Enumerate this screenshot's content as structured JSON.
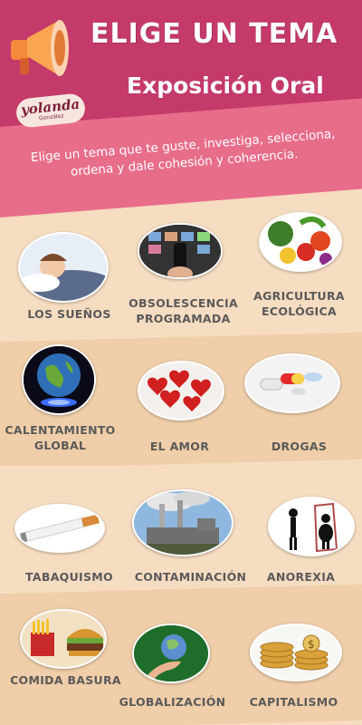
{
  "header": {
    "title_line1": "ELIGE UN TEMA",
    "title_line2": "Exposición Oral",
    "logo_name": "yolanda",
    "logo_sub": "González",
    "instructions": "Elige un tema que te guste, investiga, selecciona, ordena y dale cohesión y coherencia."
  },
  "colors": {
    "header": "#c43a6a",
    "band": "#e86d8a",
    "row_light": "#f6dcc0",
    "row_dark": "#f0cea9",
    "label": "#5a5a5a"
  },
  "topics": [
    {
      "label": "LOS SUEÑOS",
      "icon": "sleeping-child-icon"
    },
    {
      "label": "OBSOLESCENCIA PROGRAMADA",
      "icon": "tv-remote-icon"
    },
    {
      "label": "AGRICULTURA ECOLÓGICA",
      "icon": "vegetables-icon"
    },
    {
      "label": "CALENTAMIENTO GLOBAL",
      "icon": "burning-globe-icon"
    },
    {
      "label": "EL AMOR",
      "icon": "hearts-icon"
    },
    {
      "label": "DROGAS",
      "icon": "pills-icon"
    },
    {
      "label": "TABAQUISMO",
      "icon": "cigarette-icon"
    },
    {
      "label": "CONTAMINACIÓN",
      "icon": "factory-icon"
    },
    {
      "label": "ANOREXIA",
      "icon": "mirror-silhouette-icon"
    },
    {
      "label": "COMIDA BASURA",
      "icon": "fast-food-icon"
    },
    {
      "label": "GLOBALIZACIÓN",
      "icon": "hand-globe-icon"
    },
    {
      "label": "CAPITALISMO",
      "icon": "coins-icon"
    }
  ]
}
